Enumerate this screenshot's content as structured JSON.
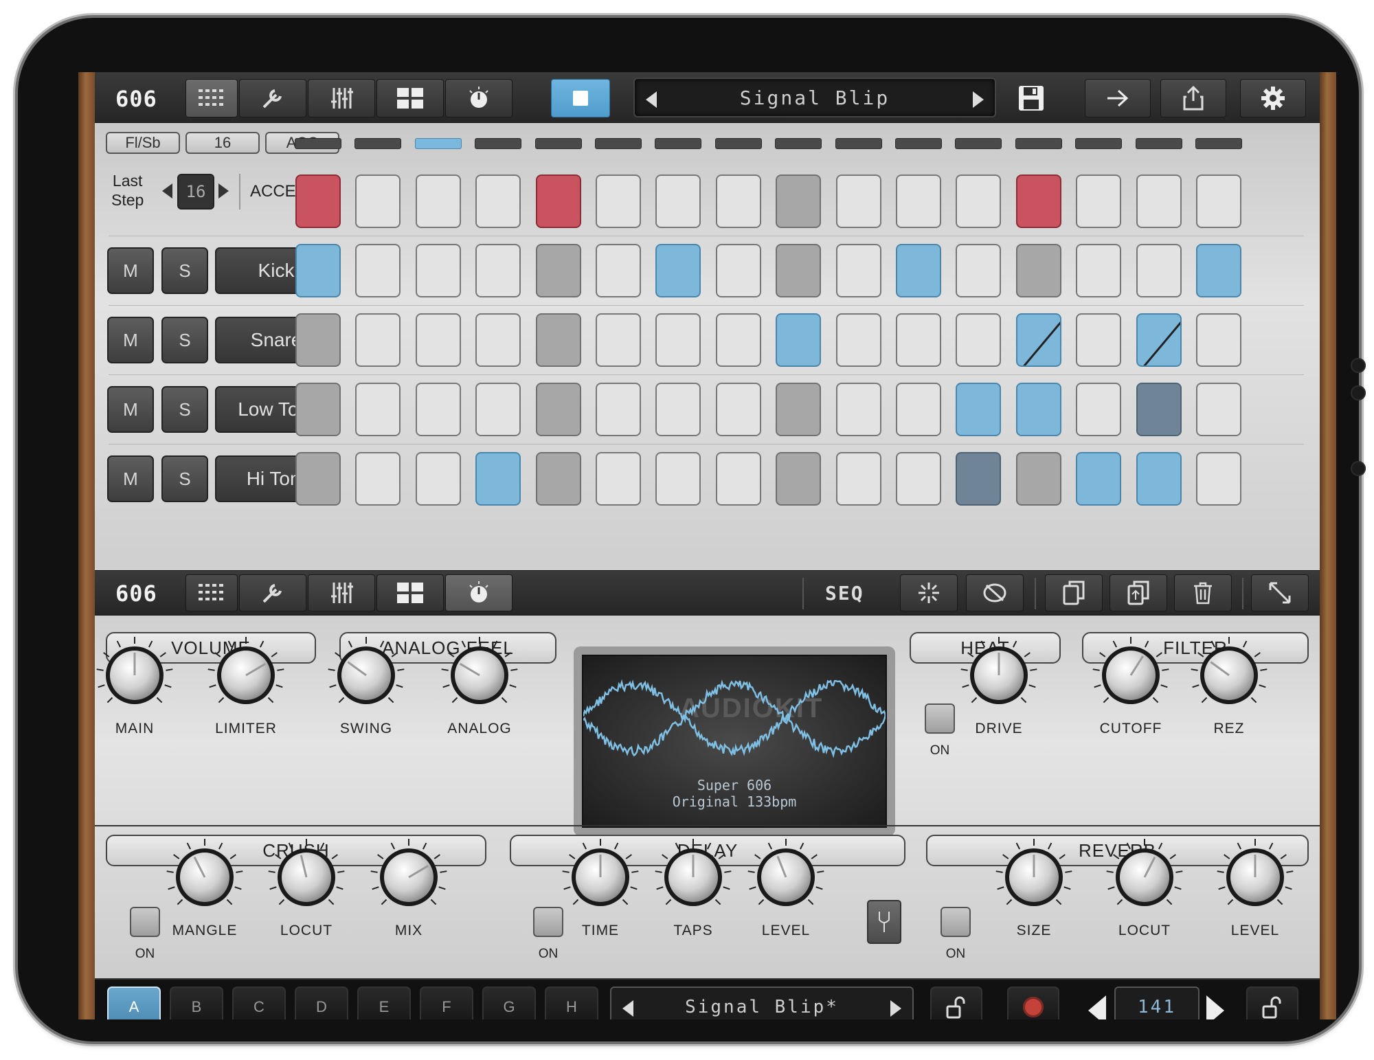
{
  "top_toolbar": {
    "logo": "606",
    "tabs": [
      "sequencer-grid-icon",
      "wrench-icon",
      "mixer-sliders-icon",
      "pads-grid-icon",
      "knob-icon"
    ],
    "transport_icon": "stop-icon",
    "pattern_name": "Signal Blip",
    "right_icons": [
      "save-icon",
      "arrow-right-icon",
      "share-icon",
      "gear-icon"
    ]
  },
  "sequencer": {
    "mode_buttons": [
      "Fl/Sb",
      "16",
      "ACC"
    ],
    "active_step_led": 3,
    "last_step_label_line1": "Last",
    "last_step_label_line2": "Step",
    "last_step_value": "16",
    "accent_label": "ACCENT",
    "accent_steps": [
      "acc",
      "off",
      "off",
      "off",
      "acc",
      "off",
      "off",
      "off",
      "gray",
      "off",
      "off",
      "off",
      "acc",
      "off",
      "off",
      "off"
    ],
    "tracks": [
      {
        "m": "M",
        "s": "S",
        "name": "Kick",
        "steps": [
          "blue",
          "off",
          "off",
          "off",
          "gray",
          "off",
          "blue",
          "off",
          "gray",
          "off",
          "blue",
          "off",
          "gray",
          "off",
          "off",
          "blue"
        ]
      },
      {
        "m": "M",
        "s": "S",
        "name": "Snare",
        "steps": [
          "gray",
          "off",
          "off",
          "off",
          "gray",
          "off",
          "off",
          "off",
          "blue",
          "off",
          "off",
          "off",
          "flam",
          "off",
          "flam",
          "off"
        ]
      },
      {
        "m": "M",
        "s": "S",
        "name": "Low Tom",
        "steps": [
          "gray",
          "off",
          "off",
          "off",
          "gray",
          "off",
          "off",
          "off",
          "gray",
          "off",
          "off",
          "blue",
          "blue",
          "off",
          "dark",
          "off"
        ]
      },
      {
        "m": "M",
        "s": "S",
        "name": "Hi Tom",
        "steps": [
          "gray",
          "off",
          "off",
          "blue",
          "gray",
          "off",
          "off",
          "off",
          "gray",
          "off",
          "off",
          "dark",
          "gray",
          "blue",
          "blue",
          "off"
        ]
      }
    ]
  },
  "mid_toolbar": {
    "logo": "606",
    "seq_label": "SEQ",
    "icons": [
      "randomize-icon",
      "clear-pattern-icon",
      "copy-icon",
      "paste-icon",
      "trash-icon",
      "expand-icon"
    ]
  },
  "fx": {
    "volume": {
      "title": "VOLUME",
      "knobs": [
        {
          "label": "MAIN",
          "value": 0.5
        },
        {
          "label": "LIMITER",
          "value": 0.72
        }
      ]
    },
    "analog": {
      "title": "ANALOG FEEL",
      "knobs": [
        {
          "label": "SWING",
          "value": 0.3
        },
        {
          "label": "ANALOG",
          "value": 0.28
        }
      ]
    },
    "display": {
      "line1": "Super 606",
      "line2": "Original 133bpm",
      "watermark": "AUDIOKIT"
    },
    "heat": {
      "title": "HEAT",
      "on_label": "ON",
      "knobs": [
        {
          "label": "DRIVE",
          "value": 0.5
        }
      ]
    },
    "filter": {
      "title": "FILTER",
      "knobs": [
        {
          "label": "CUTOFF",
          "value": 0.62
        },
        {
          "label": "REZ",
          "value": 0.3
        }
      ]
    },
    "crush": {
      "title": "CRUSH",
      "on_label": "ON",
      "knobs": [
        {
          "label": "MANGLE",
          "value": 0.4
        },
        {
          "label": "LOCUT",
          "value": 0.45
        },
        {
          "label": "MIX",
          "value": 0.72
        }
      ]
    },
    "delay": {
      "title": "DELAY",
      "on_label": "ON",
      "knobs": [
        {
          "label": "TIME",
          "value": 0.5
        },
        {
          "label": "TAPS",
          "value": 0.5
        },
        {
          "label": "LEVEL",
          "value": 0.42
        }
      ],
      "extra_icon": "tuning-fork-icon"
    },
    "reverb": {
      "title": "REVERB",
      "on_label": "ON",
      "knobs": [
        {
          "label": "SIZE",
          "value": 0.5
        },
        {
          "label": "LOCUT",
          "value": 0.6
        },
        {
          "label": "LEVEL",
          "value": 0.5
        }
      ]
    }
  },
  "bottom_bar": {
    "pattern_buttons": [
      "A",
      "B",
      "C",
      "D",
      "E",
      "F",
      "G",
      "H"
    ],
    "selected_pattern": "A",
    "pattern_name": "Signal Blip*",
    "lock_icon": "unlock-icon",
    "record_icon": "record-icon",
    "tempo": "141",
    "tempo_lock_icon": "unlock-icon"
  },
  "colors": {
    "accent_red": "#c9545f",
    "step_blue": "#7db7da",
    "led_blue": "#7ab8dd",
    "wave": "#7fbfe4"
  }
}
